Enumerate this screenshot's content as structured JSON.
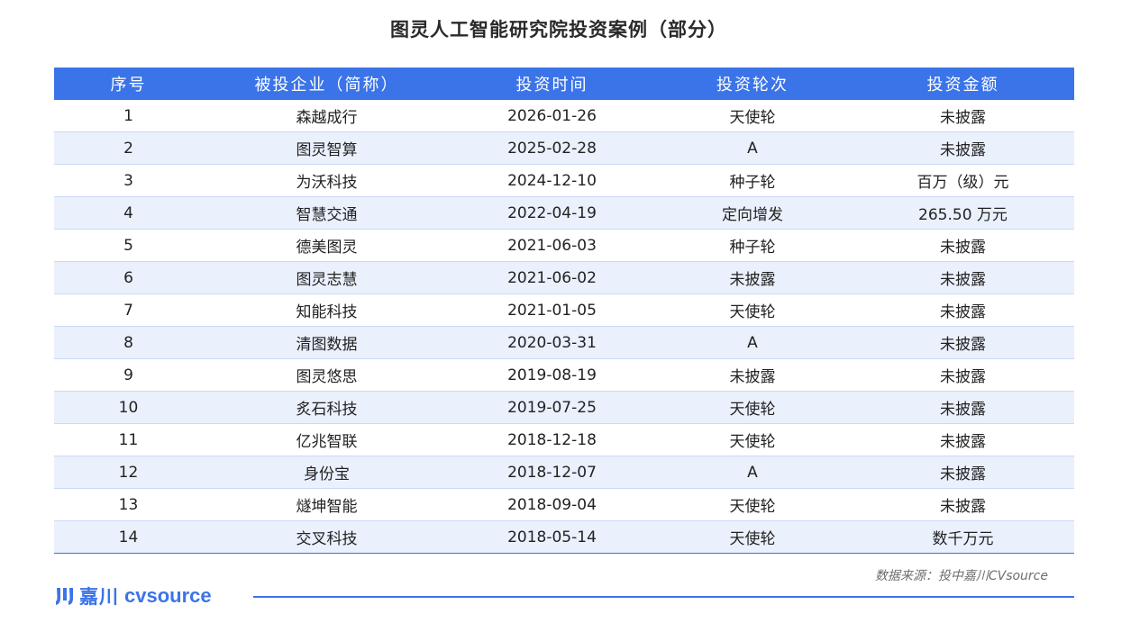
{
  "title": "图灵人工智能研究院投资案例（部分）",
  "table": {
    "headers": [
      "序号",
      "被投企业（简称）",
      "投资时间",
      "投资轮次",
      "投资金额"
    ],
    "rows": [
      [
        "1",
        "森越成行",
        "2026-01-26",
        "天使轮",
        "未披露"
      ],
      [
        "2",
        "图灵智算",
        "2025-02-28",
        "A",
        "未披露"
      ],
      [
        "3",
        "为沃科技",
        "2024-12-10",
        "种子轮",
        "百万（级）元"
      ],
      [
        "4",
        "智慧交通",
        "2022-04-19",
        "定向增发",
        "265.50 万元"
      ],
      [
        "5",
        "德美图灵",
        "2021-06-03",
        "种子轮",
        "未披露"
      ],
      [
        "6",
        "图灵志慧",
        "2021-06-02",
        "未披露",
        "未披露"
      ],
      [
        "7",
        "知能科技",
        "2021-01-05",
        "天使轮",
        "未披露"
      ],
      [
        "8",
        "清图数据",
        "2020-03-31",
        "A",
        "未披露"
      ],
      [
        "9",
        "图灵悠思",
        "2019-08-19",
        "未披露",
        "未披露"
      ],
      [
        "10",
        "炙石科技",
        "2019-07-25",
        "天使轮",
        "未披露"
      ],
      [
        "11",
        "亿兆智联",
        "2018-12-18",
        "天使轮",
        "未披露"
      ],
      [
        "12",
        "身份宝",
        "2018-12-07",
        "A",
        "未披露"
      ],
      [
        "13",
        "燧坤智能",
        "2018-09-04",
        "天使轮",
        "未披露"
      ],
      [
        "14",
        "交叉科技",
        "2018-05-14",
        "天使轮",
        "数千万元"
      ]
    ]
  },
  "source": "数据来源：投中嘉川CVsource",
  "logo": {
    "icon": "jiachuan-logo-icon",
    "cn": "嘉川",
    "en": "cvsource"
  },
  "colors": {
    "accent": "#3b74e8",
    "stripe": "#eaf0fc"
  }
}
